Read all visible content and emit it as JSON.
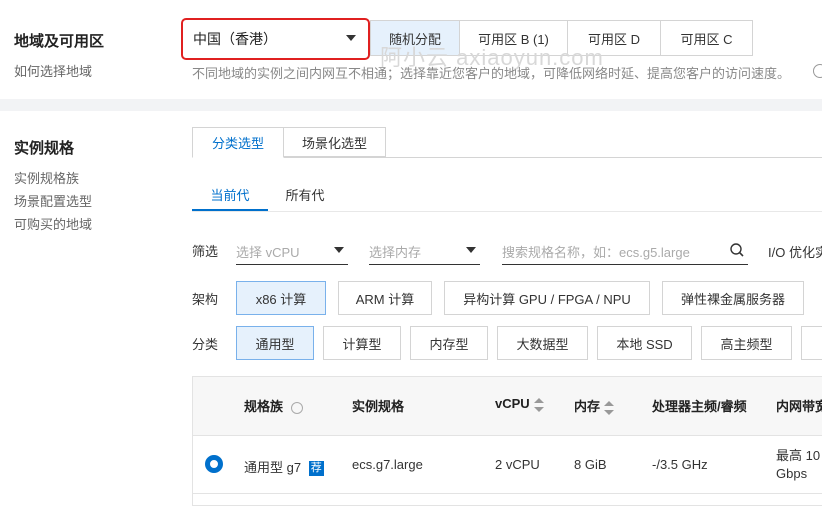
{
  "region": {
    "title": "地域及可用区",
    "help_link": "如何选择地域",
    "selected_region": "中国（香港）",
    "zones": [
      "随机分配",
      "可用区 B (1)",
      "可用区 D",
      "可用区 C"
    ],
    "hint": "不同地域的实例之间内网互不相通；选择靠近您客户的地域，可降低网络时延、提高您客户的访问速度。"
  },
  "spec": {
    "title": "实例规格",
    "side_links": [
      "实例规格族",
      "场景配置选型",
      "可购买的地域"
    ],
    "tabs": [
      "分类选型",
      "场景化选型"
    ],
    "sub_tabs": [
      "当前代",
      "所有代"
    ],
    "filter": {
      "label": "筛选",
      "vcpu_placeholder": "选择 vCPU",
      "mem_placeholder": "选择内存",
      "search_placeholder": "搜索规格名称，如：ecs.g5.large",
      "io_label": "I/O 优化实"
    },
    "arch": {
      "label": "架构",
      "options": [
        "x86 计算",
        "ARM 计算",
        "异构计算 GPU / FPGA / NPU",
        "弹性裸金属服务器"
      ]
    },
    "category": {
      "label": "分类",
      "options": [
        "通用型",
        "计算型",
        "内存型",
        "大数据型",
        "本地 SSD",
        "高主频型"
      ]
    },
    "table": {
      "headers": [
        "规格族",
        "实例规格",
        "vCPU",
        "内存",
        "处理器主频/睿频",
        "内网带宽"
      ],
      "rows": [
        {
          "family": "通用型 g7",
          "badge": "荐",
          "spec": "ecs.g7.large",
          "vcpu": "2 vCPU",
          "memory": "8 GiB",
          "freq": "-/3.5 GHz",
          "bandwidth_line1": "最高 10",
          "bandwidth_line2": "Gbps"
        }
      ]
    }
  },
  "watermark": "阿小云 axiaoyun.com",
  "colors": {
    "accent": "#0070cc",
    "highlight_border": "#e02020",
    "selected_bg": "#e6f1fc"
  }
}
